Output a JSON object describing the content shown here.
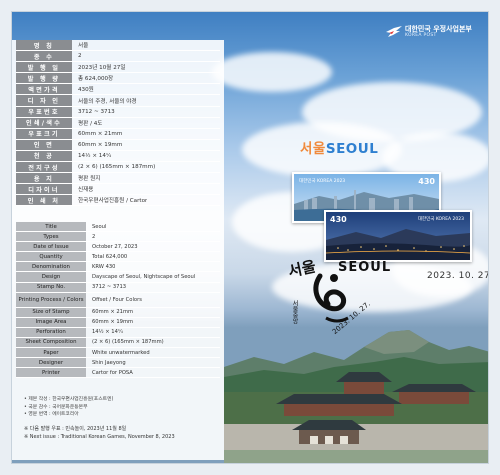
{
  "korea_post": {
    "name_kr": "대한민국 우정사업본부",
    "name_en": "KOREA POST"
  },
  "info_kr": [
    {
      "key": "명 칭",
      "value": "서울"
    },
    {
      "key": "종 수",
      "value": "2"
    },
    {
      "key": "발 행 일",
      "value": "2023년 10월 27일"
    },
    {
      "key": "발 행 량",
      "value": "총 624,000장"
    },
    {
      "key": "액면가격",
      "value": "430원"
    },
    {
      "key": "디 자 인",
      "value": "서울의 주경, 서울의 야경"
    },
    {
      "key": "우표번호",
      "value": "3712 ~ 3713"
    },
    {
      "key": "인쇄/색수",
      "value": "평판 / 4도"
    },
    {
      "key": "우표크기",
      "value": "60mm × 21mm"
    },
    {
      "key": "인 면",
      "value": "60mm × 19mm"
    },
    {
      "key": "천 공",
      "value": "14½ × 14¼"
    },
    {
      "key": "전지구성",
      "value": "(2 × 6) (165mm × 187mm)"
    },
    {
      "key": "용 지",
      "value": "평판 원지"
    },
    {
      "key": "디자이너",
      "value": "신재용"
    },
    {
      "key": "인 쇄 처",
      "value": "한국우편사업진흥원 / Cartor"
    }
  ],
  "info_en": [
    {
      "key": "Title",
      "value": "Seoul"
    },
    {
      "key": "Types",
      "value": "2"
    },
    {
      "key": "Date of Issue",
      "value": "October 27, 2023"
    },
    {
      "key": "Quantity",
      "value": "Total 624,000"
    },
    {
      "key": "Denomination",
      "value": "KRW 430"
    },
    {
      "key": "Design",
      "value": "Dayscape of Seoul, Nightscape of Seoul"
    },
    {
      "key": "Stamp No.",
      "value": "3712 ~ 3713"
    },
    {
      "key": "Printing Process / Colors",
      "value": "Offset / Four Colors"
    },
    {
      "key": "Size of Stamp",
      "value": "60mm × 21mm"
    },
    {
      "key": "Image Area",
      "value": "60mm × 19mm"
    },
    {
      "key": "Perforation",
      "value": "14½ × 14¼"
    },
    {
      "key": "Sheet Composition",
      "value": "(2 × 6) (165mm × 187mm)"
    },
    {
      "key": "Paper",
      "value": "White unwatermarked"
    },
    {
      "key": "Designer",
      "value": "Shin Jaeyong"
    },
    {
      "key": "Printer",
      "value": "Cartor for POSA"
    }
  ],
  "notes": [
    "• 제본 작성 : 한국우편사업진흥원(포스트엔)",
    "• 국문 감수 : 국어문화운동본부",
    "• 영문 번역 : 에이트코리아"
  ],
  "next_issue": {
    "kr": "※ 다음 발행 우표 : 민속놀이, 2023년 11월 8일",
    "en": "※ Next issue : Traditional Korean Games, November 8, 2023"
  },
  "title": {
    "part1": "서울",
    "part2": "SEOUL"
  },
  "stamps": [
    {
      "label": "대한민국 KOREA 2023",
      "denomination": "430"
    },
    {
      "label": "대한민국 KOREA 2023",
      "denomination": "430"
    }
  ],
  "postmark": {
    "text_kr": "서울",
    "text_en": "SEOUL",
    "date": "2023. 10. 27.",
    "side_text": "서울중앙"
  }
}
